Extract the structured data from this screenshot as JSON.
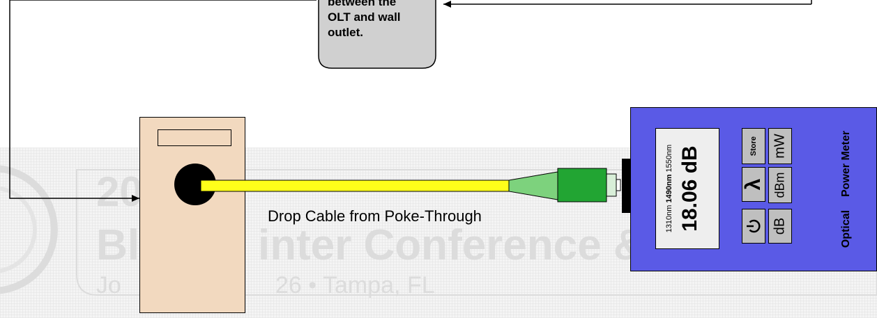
{
  "watermark": {
    "year_fragment": "20",
    "title_fragment_left": "Bl",
    "title_fragment_right": "inter Conference &",
    "date_fragment_left": "Jo",
    "date_fragment_right": "26 • Tampa, FL"
  },
  "callout": {
    "text": "between the\nOLT and wall\noutlet."
  },
  "wall_outlet": {
    "cable_label": "Drop Cable from Poke-Through"
  },
  "power_meter": {
    "wavelengths": {
      "w1": "1310nm ",
      "w2": "1490nm",
      "w3": " 1550nm"
    },
    "reading": "18.06 dB",
    "buttons": {
      "store": "Store",
      "mw": "mW",
      "lambda": "λ",
      "dbm": "dBm",
      "db": "dB"
    },
    "title_word1": "Optical",
    "title_word2": "Power Meter"
  },
  "colors": {
    "meter_body": "#5a5ae6",
    "outlet_body": "#f2d9bf",
    "cable": "#ffff1a",
    "connector": "#22a533",
    "callout_fill": "#d0d0d0"
  }
}
